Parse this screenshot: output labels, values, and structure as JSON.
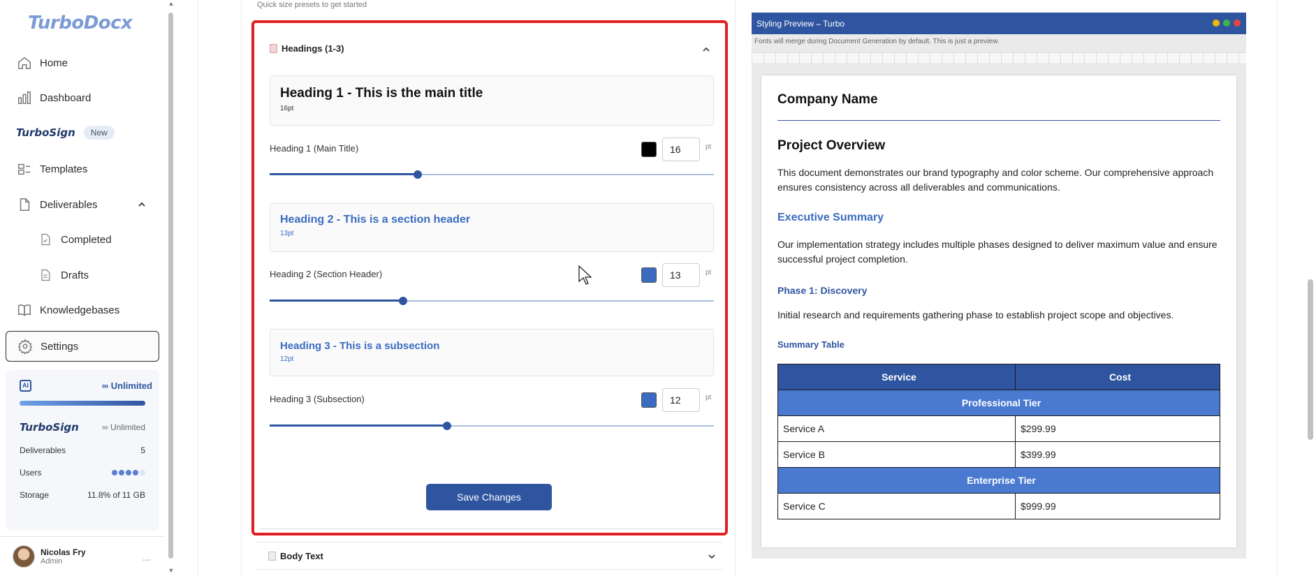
{
  "sidebar": {
    "logo": "TurboDocx",
    "nav": {
      "home": "Home",
      "dashboard": "Dashboard",
      "turbosign": "TurboSign",
      "turbosign_badge": "New",
      "templates": "Templates",
      "deliverables": "Deliverables",
      "completed": "Completed",
      "drafts": "Drafts",
      "knowledgebases": "Knowledgebases",
      "settings": "Settings"
    },
    "plan": {
      "ai_label": "AI",
      "ai_unlimited": "Unlimited",
      "turbosign_label": "TurboSign",
      "turbosign_unlimited": "Unlimited",
      "deliverables_label": "Deliverables",
      "deliverables_value": "5",
      "users_label": "Users",
      "storage_label": "Storage",
      "storage_value": "11.8% of 11 GB"
    },
    "user": {
      "name": "Nicolas Fry",
      "role": "Admin",
      "more": "..."
    }
  },
  "main": {
    "presets_note": "Quick size presets to get started",
    "section_title": "Headings (1-3)",
    "headings": [
      {
        "preview": "Heading 1 - This is the main title",
        "preview_size": "16pt",
        "label": "Heading 1 (Main Title)",
        "size": "16",
        "unit": "pt",
        "color": "#000000",
        "slider_fraction": 0.333
      },
      {
        "preview": "Heading 2 - This is a section header",
        "preview_size": "13pt",
        "label": "Heading 2 (Section Header)",
        "size": "13",
        "unit": "pt",
        "color": "#3a6bc0",
        "slider_fraction": 0.3
      },
      {
        "preview": "Heading 3 - This is a subsection",
        "preview_size": "12pt",
        "label": "Heading 3 (Subsection)",
        "size": "12",
        "unit": "pt",
        "color": "#3a6bc0",
        "slider_fraction": 0.4
      }
    ],
    "save_button": "Save Changes",
    "body_text_section": "Body Text"
  },
  "styling_preview": {
    "title": "Styling Preview – Turbo",
    "note": "Fonts will merge during Document Generation by default. This is just a preview.",
    "company": "Company Name",
    "project_overview": "Project Overview",
    "p1": "This document demonstrates our brand typography and color scheme. Our comprehensive approach ensures consistency across all deliverables and communications.",
    "exec_summary": "Executive Summary",
    "p2": "Our implementation strategy includes multiple phases designed to deliver maximum value and ensure successful project completion.",
    "phase1": "Phase 1: Discovery",
    "p3": "Initial research and requirements gathering phase to establish project scope and objectives.",
    "summary_table": "Summary Table",
    "table": {
      "headers": [
        "Service",
        "Cost"
      ],
      "tier1": "Professional Tier",
      "rows1": [
        [
          "Service A",
          "$299.99"
        ],
        [
          "Service B",
          "$399.99"
        ]
      ],
      "tier2": "Enterprise Tier",
      "rows2": [
        [
          "Service C",
          "$999.99"
        ]
      ]
    }
  },
  "colors": {
    "accent": "#2f55a0",
    "highlight_border": "#e02020",
    "heading_blue": "#3a6bc0"
  }
}
